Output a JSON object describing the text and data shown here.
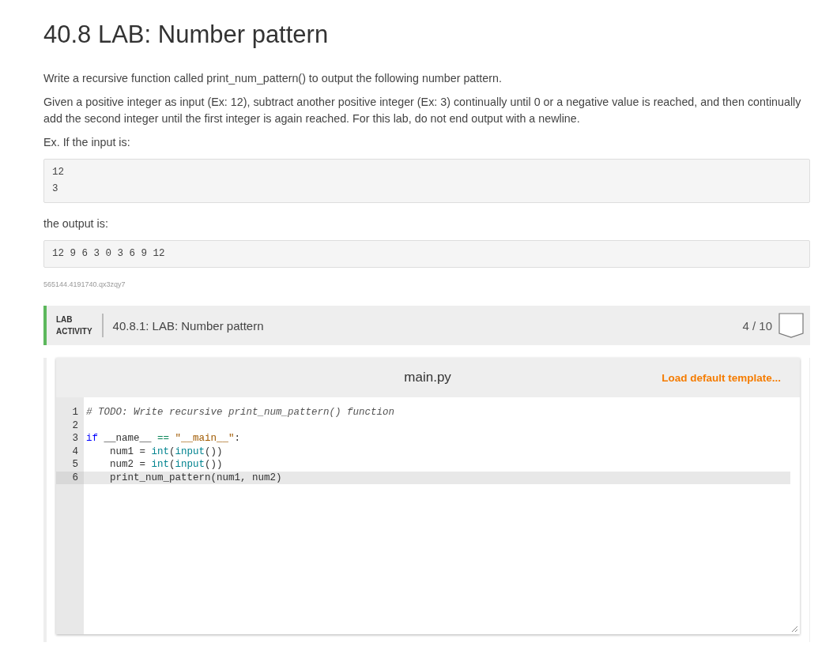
{
  "title": "40.8 LAB: Number pattern",
  "paragraphs": [
    "Write a recursive function called print_num_pattern() to output the following number pattern.",
    "Given a positive integer as input (Ex: 12), subtract another positive integer (Ex: 3) continually until 0 or a negative value is reached, and then continually add the second integer until the first integer is again reached. For this lab, do not end output with a newline.",
    "Ex. If the input is:"
  ],
  "input_example": [
    "12",
    "3"
  ],
  "output_label": "the output is:",
  "output_example": [
    "12 9 6 3 0 3 6 9 12"
  ],
  "code_id": "565144.4191740.qx3zqy7",
  "activity": {
    "type_label": [
      "LAB",
      "ACTIVITY"
    ],
    "title": "40.8.1: LAB: Number pattern",
    "score": "4 / 10",
    "complete": false
  },
  "editor": {
    "filename": "main.py",
    "load_template": "Load default template...",
    "lines": [
      {
        "number": "1",
        "selected": false,
        "tokens": [
          {
            "kind": "comment",
            "text": "# TODO: Write recursive print_num_pattern() function"
          }
        ]
      },
      {
        "number": "2",
        "selected": false
      },
      {
        "number": "3",
        "selected": false,
        "tokens": [
          {
            "kind": "keyword",
            "text": "if"
          },
          {
            "kind": "plain",
            "text": " __name__ "
          },
          {
            "kind": "operator",
            "text": "=="
          },
          {
            "kind": "string",
            "text": " \"__main__\""
          },
          {
            "kind": "plain",
            "text": ":"
          }
        ]
      },
      {
        "number": "4",
        "selected": false,
        "tokens": [
          {
            "kind": "plain",
            "text": "    num1 = "
          },
          {
            "kind": "builtin",
            "text": "int"
          },
          {
            "kind": "plain",
            "text": "("
          },
          {
            "kind": "builtin",
            "text": "input"
          },
          {
            "kind": "plain",
            "text": "())"
          }
        ]
      },
      {
        "number": "5",
        "selected": false,
        "tokens": [
          {
            "kind": "plain",
            "text": "    num2 = "
          },
          {
            "kind": "builtin",
            "text": "int"
          },
          {
            "kind": "plain",
            "text": "("
          },
          {
            "kind": "builtin",
            "text": "input"
          },
          {
            "kind": "plain",
            "text": "())"
          }
        ]
      },
      {
        "number": "6",
        "selected": true,
        "tokens": [
          {
            "kind": "plain",
            "text": "    print_num_pattern(num1, num2)"
          }
        ]
      }
    ]
  }
}
